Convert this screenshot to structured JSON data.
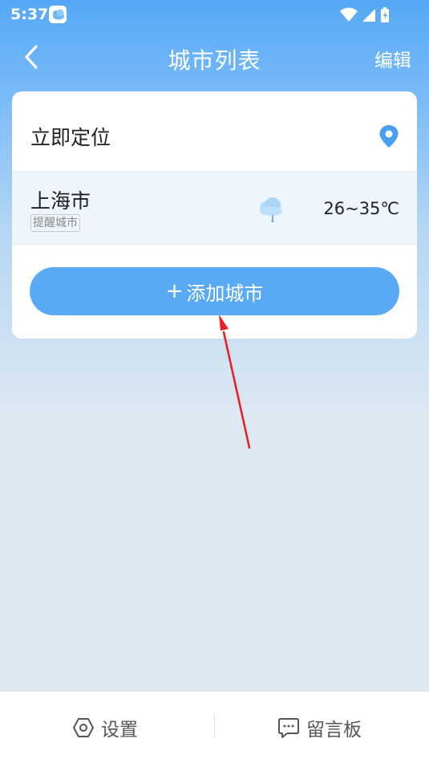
{
  "status_bar": {
    "time": "5:37"
  },
  "header": {
    "title": "城市列表",
    "edit_label": "编辑"
  },
  "locate": {
    "label": "立即定位"
  },
  "cities": [
    {
      "name": "上海市",
      "tag": "提醒城市",
      "weather_icon": "light-rain-cloud-icon",
      "temperature": "26~35℃"
    }
  ],
  "add_button": {
    "plus": "+",
    "label": "添加城市"
  },
  "tabbar": {
    "settings_label": "设置",
    "board_label": "留言板"
  },
  "colors": {
    "accent": "#5aa9f4",
    "header_top": "#55a8f6",
    "page_bg": "#dde8f2",
    "annotation_arrow": "#e8202a"
  }
}
